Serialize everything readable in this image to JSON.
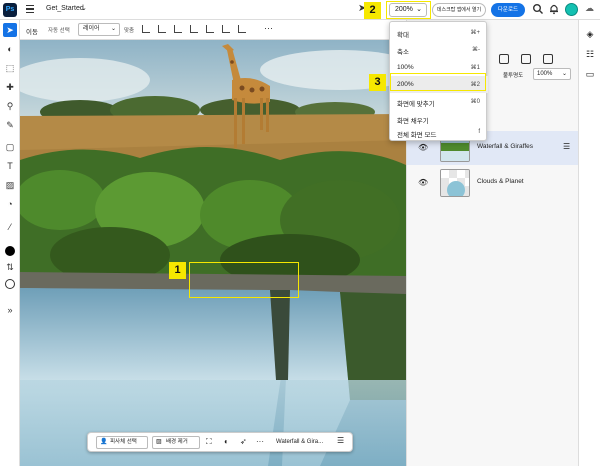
{
  "topbar": {
    "doc_title": "Get_Started",
    "zoom_value": "200%",
    "desktop_button": "데스크탑 앱에서 열기",
    "download_button": "다운로드"
  },
  "options": {
    "move_label": "이동",
    "auto_select_label": "자동 선택",
    "layer_select": "레이어",
    "align_label": "맞춤",
    "more": "···"
  },
  "zoom_menu": {
    "items": [
      {
        "label": "확대",
        "shortcut": "⌘+"
      },
      {
        "label": "축소",
        "shortcut": "⌘-"
      },
      {
        "label": "100%",
        "shortcut": "⌘1"
      },
      {
        "label": "200%",
        "shortcut": "⌘2"
      },
      {
        "label": "화면에 맞추기",
        "shortcut": "⌘0"
      },
      {
        "label": "화면 채우기",
        "shortcut": ""
      },
      {
        "label": "전체 화면 모드",
        "shortcut": "f"
      }
    ],
    "highlighted_index": 3
  },
  "layers_panel": {
    "opacity_label": "불투명도",
    "opacity_value": "100%",
    "partial_layer_tail": "n",
    "layers": [
      {
        "name": "Waterfall & Giraffes",
        "selected": true
      },
      {
        "name": "Clouds & Planet",
        "selected": false
      }
    ]
  },
  "floatbar": {
    "select_subject": "피사체 선택",
    "remove_background": "배경 제거",
    "more": "···",
    "layer_name": "Waterfall & Gira..."
  },
  "callouts": [
    {
      "number": "1"
    },
    {
      "number": "2"
    },
    {
      "number": "3"
    }
  ],
  "colors": {
    "accent": "#1473e6",
    "callout": "#f6e800",
    "selected_layer_bg": "#e1e8f6"
  }
}
